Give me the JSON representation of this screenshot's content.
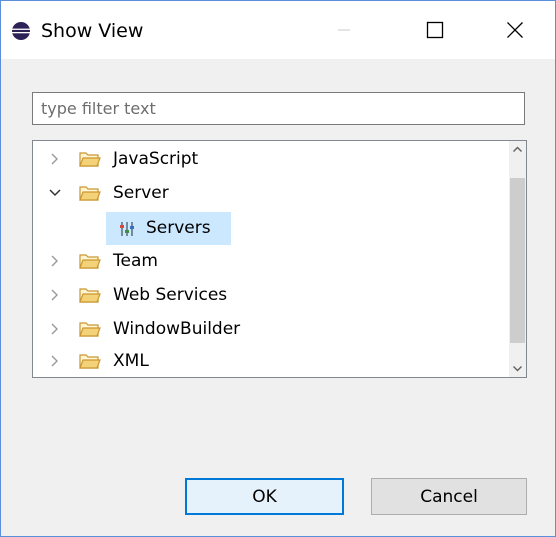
{
  "window": {
    "title": "Show View",
    "title_icon": "eclipse-icon",
    "controls": {
      "minimize_icon": "minimize-icon",
      "maximize_icon": "maximize-icon",
      "close_icon": "close-icon"
    }
  },
  "filter": {
    "placeholder": "type filter text",
    "value": ""
  },
  "tree": {
    "items": [
      {
        "label": "JavaScript",
        "expanded": false,
        "icon": "folder-icon"
      },
      {
        "label": "Server",
        "expanded": true,
        "icon": "folder-icon",
        "children": [
          {
            "label": "Servers",
            "icon": "servers-icon",
            "selected": true
          }
        ]
      },
      {
        "label": "Team",
        "expanded": false,
        "icon": "folder-icon"
      },
      {
        "label": "Web Services",
        "expanded": false,
        "icon": "folder-icon"
      },
      {
        "label": "WindowBuilder",
        "expanded": false,
        "icon": "folder-icon"
      },
      {
        "label": "XML",
        "expanded": false,
        "icon": "folder-icon"
      }
    ]
  },
  "buttons": {
    "ok": "OK",
    "cancel": "Cancel"
  },
  "colors": {
    "selection": "#cce8ff",
    "accent": "#0078d7",
    "folder": "#e8b84a"
  }
}
